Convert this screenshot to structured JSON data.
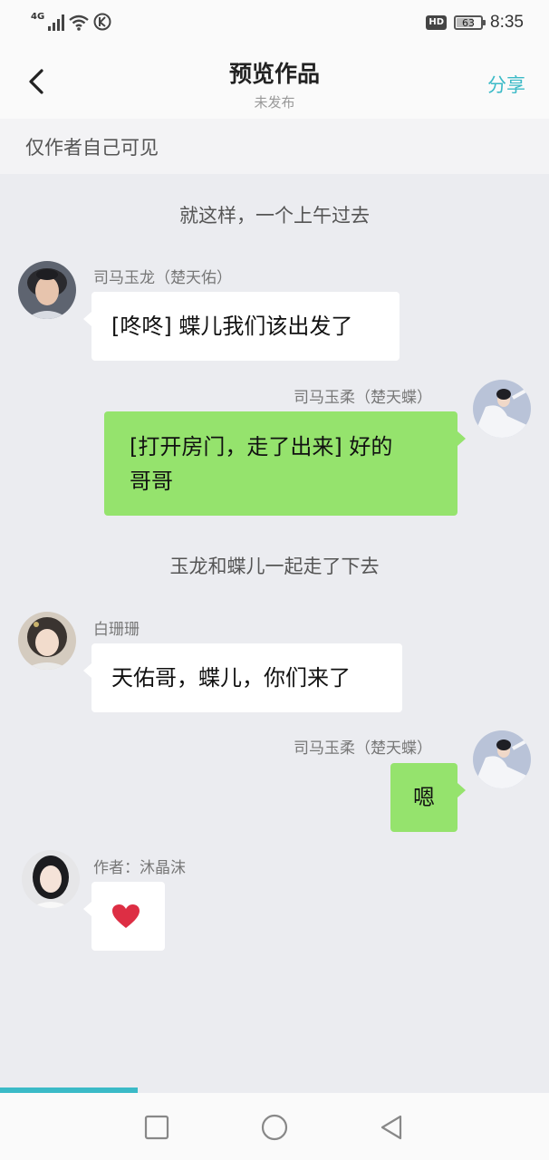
{
  "status_bar": {
    "network": "4G",
    "hd": "HD",
    "battery": "63",
    "battery_level": 0.63,
    "time": "8:35"
  },
  "header": {
    "title": "预览作品",
    "subtitle": "未发布",
    "share_label": "分享"
  },
  "visibility_label": "仅作者自己可见",
  "messages": {
    "narration1": "就这样，一个上午过去",
    "m1": {
      "name": "司马玉龙（楚天佑）",
      "text": "[咚咚] 蝶儿我们该出发了"
    },
    "m2": {
      "name": "司马玉柔（楚天蝶）",
      "line1": "[打开房门，走了出来] 好的",
      "line2": "哥哥"
    },
    "narration2": "玉龙和蝶儿一起走了下去",
    "m3": {
      "name": "白珊珊",
      "text": "天佑哥，蝶儿，你们来了"
    },
    "m4": {
      "name": "司马玉柔（楚天蝶）",
      "text": "嗯"
    },
    "m5": {
      "name": "作者：沐晶沫",
      "emoji": "❤️"
    }
  },
  "reading_progress": 0.25,
  "nav": {
    "recent": "recent-apps-icon",
    "home": "home-icon",
    "back": "back-icon"
  }
}
